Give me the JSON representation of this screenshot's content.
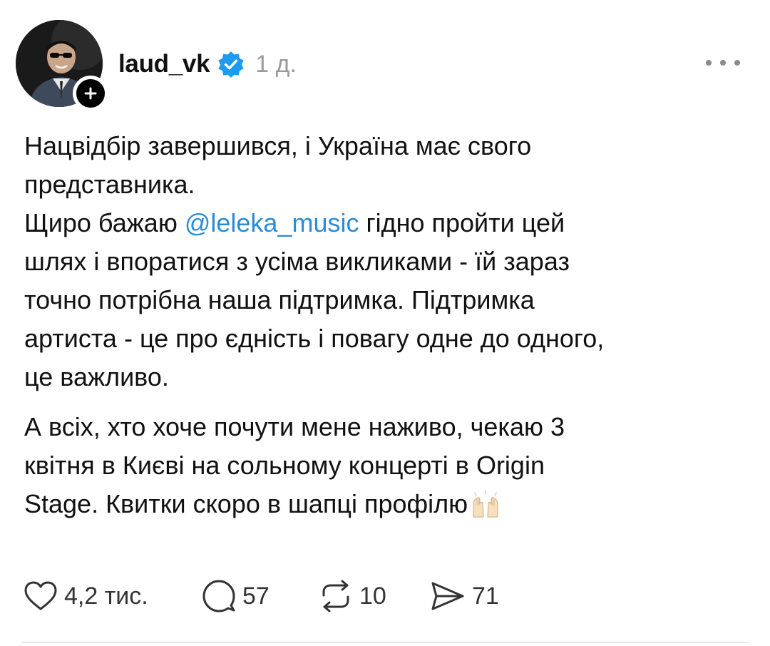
{
  "post": {
    "author": {
      "username": "laud_vk",
      "verified": true,
      "avatar": "profile-photo-man-in-sunglasses",
      "follow_icon": "plus-icon"
    },
    "timestamp": "1 д.",
    "more_icon": "more-horizontal-icon",
    "body": {
      "paragraph1": {
        "line1": "Нацвідбір завершився, і Україна має свого",
        "line2": "представника.",
        "line3_before": "Щиро бажаю ",
        "line3_mention": "@leleka_music",
        "line3_after": " гідно пройти цей",
        "line4": "шлях і впоратися з усіма викликами - їй зараз",
        "line5": "точно потрібна наша підтримка. Підтримка",
        "line6": "артиста - це про єдність і повагу одне до одного,",
        "line7": "це важливо."
      },
      "paragraph2": {
        "line1": "А всіх, хто хоче почути мене наживо, чекаю 3",
        "line2": "квітня в Києві на сольному концерті в Origin",
        "line3": "Stage. Квитки скоро в шапці профілю",
        "emoji": "raising-hands-emoji"
      }
    },
    "actions": {
      "likes": "4,2 тис.",
      "replies": "57",
      "reposts": "10",
      "shares": "71"
    },
    "colors": {
      "mention": "#2a8bd6",
      "verified_badge": "#1d9bf0",
      "meta_gray": "#9a9a9a"
    }
  }
}
